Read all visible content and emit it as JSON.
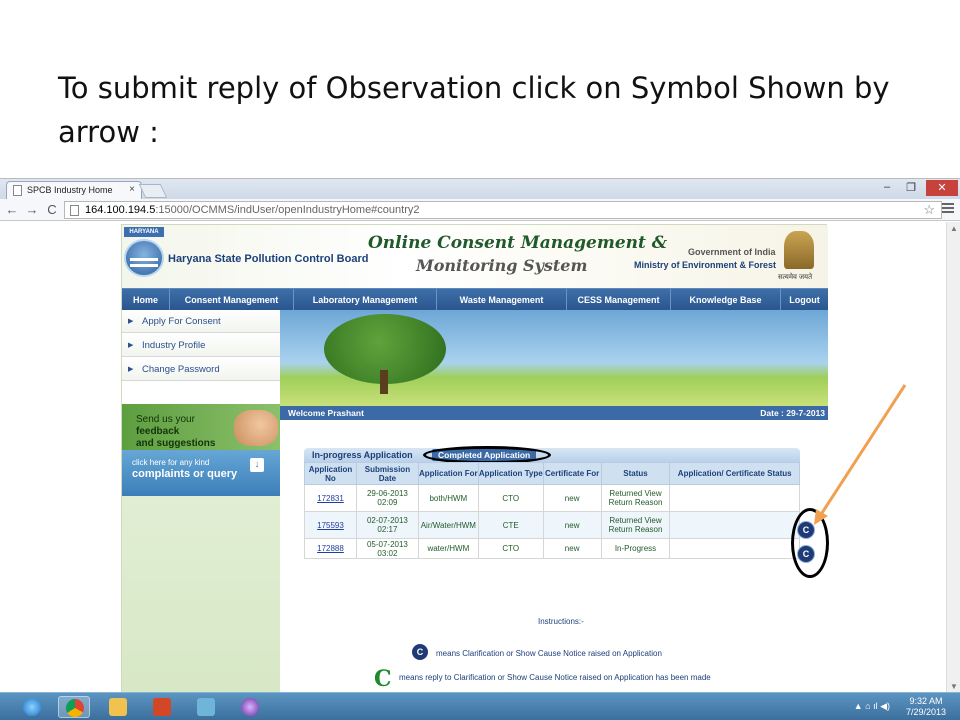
{
  "slide": {
    "title": "To submit reply of Observation click on Symbol Shown by arrow :"
  },
  "browser": {
    "tab_title": "SPCB Industry Home",
    "tab_close": "×",
    "url_host": "164.100.194.5",
    "url_rest": ":15000/OCMMS/indUser/openIndustryHome#country2",
    "back": "←",
    "forward": "→",
    "reload": "C",
    "star": "☆",
    "minimize": "–",
    "restore": "❐",
    "close": "✕"
  },
  "site": {
    "logo_tag": "HARYANA",
    "board_name": "Haryana State Pollution Control Board",
    "ocms_line1": "Online Consent Management &",
    "ocms_line2": "Monitoring System",
    "goi": "Government of India",
    "ministry": "Ministry of Environment & Forest",
    "motto": "सत्यमेव जयते",
    "nav": [
      "Home",
      "Consent Management",
      "Laboratory Management",
      "Waste Management",
      "CESS Management",
      "Knowledge Base",
      "Logout"
    ],
    "side_menu": [
      "Apply For Consent",
      "Industry Profile",
      "Change Password"
    ],
    "feedback_line1": "Send us your",
    "feedback_bold1": "feedback",
    "feedback_line2": "and suggestions",
    "complaint_line1": "click here for any kind",
    "complaint_line2": "complaints or query",
    "complaint_arrow": "↓",
    "welcome": "Welcome Prashant",
    "date": "Date : 29-7-2013"
  },
  "applications": {
    "tab_inprogress": "In-progress Application",
    "tab_completed": "Completed Application",
    "headers": [
      "Application No",
      "Submission Date",
      "Application For",
      "Application Type",
      "Certificate For",
      "Status",
      "Application/ Certificate Status"
    ],
    "rows": [
      {
        "app_no": "172831",
        "date": "29-06-2013 02:09",
        "for": "both/HWM",
        "type": "CTO",
        "cert": "new",
        "status": "Returned View Return Reason",
        "cert_status": ""
      },
      {
        "app_no": "175593",
        "date": "02-07-2013 02:17",
        "for": "Air/Water/HWM",
        "type": "CTE",
        "cert": "new",
        "status": "Returned View Return Reason",
        "cert_status": ""
      },
      {
        "app_no": "172888",
        "date": "05-07-2013 03:02",
        "for": "water/HWM",
        "type": "CTO",
        "cert": "new",
        "status": "In-Progress",
        "cert_status": ""
      }
    ],
    "row_icon": "C"
  },
  "instructions": {
    "heading": "Instructions:-",
    "legend1_icon": "C",
    "legend1_text": "means Clarification or Show Cause Notice raised on Application",
    "legend2_icon": "C",
    "legend2_text": "means reply to Clarification or Show Cause Notice raised on Application has been made"
  },
  "taskbar": {
    "time": "9:32 AM",
    "date": "7/29/2013",
    "tray": "▲  ⌂  ıl  ◀)"
  },
  "colors": {
    "arrow": "#f0a050",
    "nav_blue": "#2b5690",
    "clarification_icon": "#1e3b78",
    "reply_icon": "#1e8a2a"
  }
}
